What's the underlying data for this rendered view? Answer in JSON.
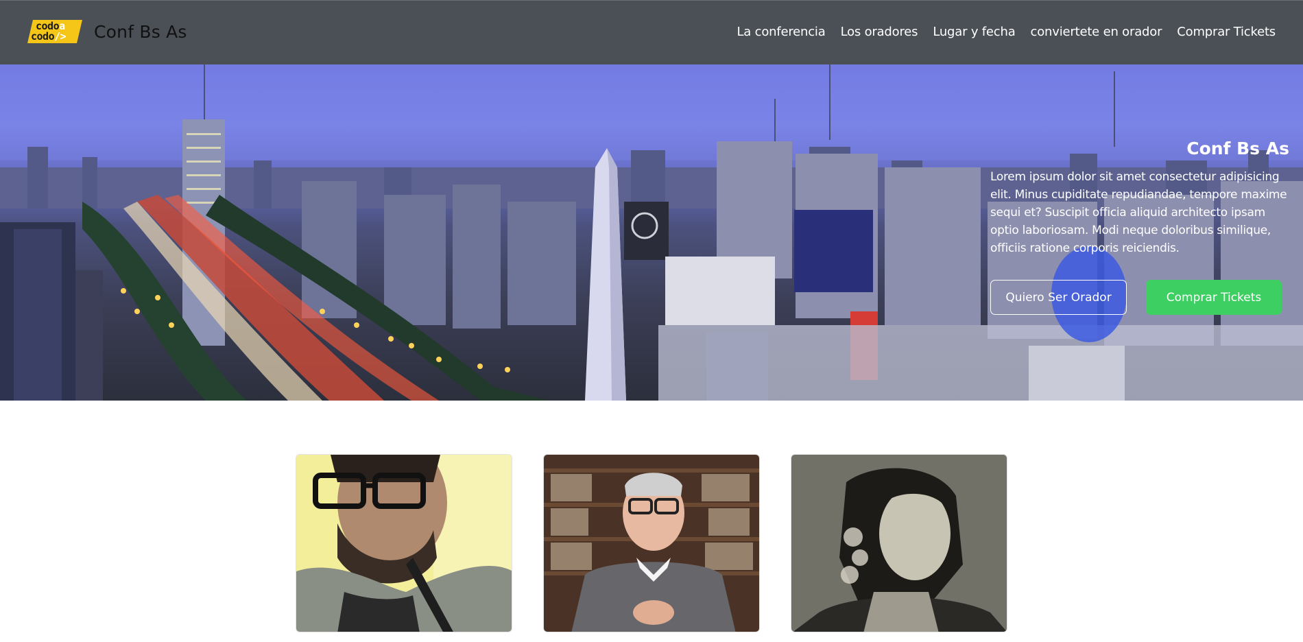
{
  "navbar": {
    "logo": {
      "line1": "codo",
      "line1_accent": "a",
      "line2": "codo",
      "line2_accent": "/>"
    },
    "brand_title": "Conf Bs As",
    "links": [
      "La conferencia",
      "Los oradores",
      "Lugar y fecha",
      "conviertete en orador",
      "Comprar Tickets"
    ]
  },
  "hero": {
    "title": "Conf Bs As",
    "text": "Lorem ipsum dolor sit amet consectetur adipisicing elit. Minus cupiditate repudiandae, tempore maxime sequi et? Suscipit officia aliquid architecto ipsam optio laboriosam. Modi neque doloribus similique, officiis ratione corporis reiciendis.",
    "button_orador": "Quiero Ser Orador",
    "button_tickets": "Comprar Tickets"
  },
  "speakers": [
    {
      "name": "speaker-photo-1"
    },
    {
      "name": "speaker-photo-2"
    },
    {
      "name": "speaker-photo-3"
    }
  ],
  "colors": {
    "navbar_bg": "#4b5056",
    "accent_green": "#3ecf62",
    "logo_yellow": "#f5c518"
  }
}
